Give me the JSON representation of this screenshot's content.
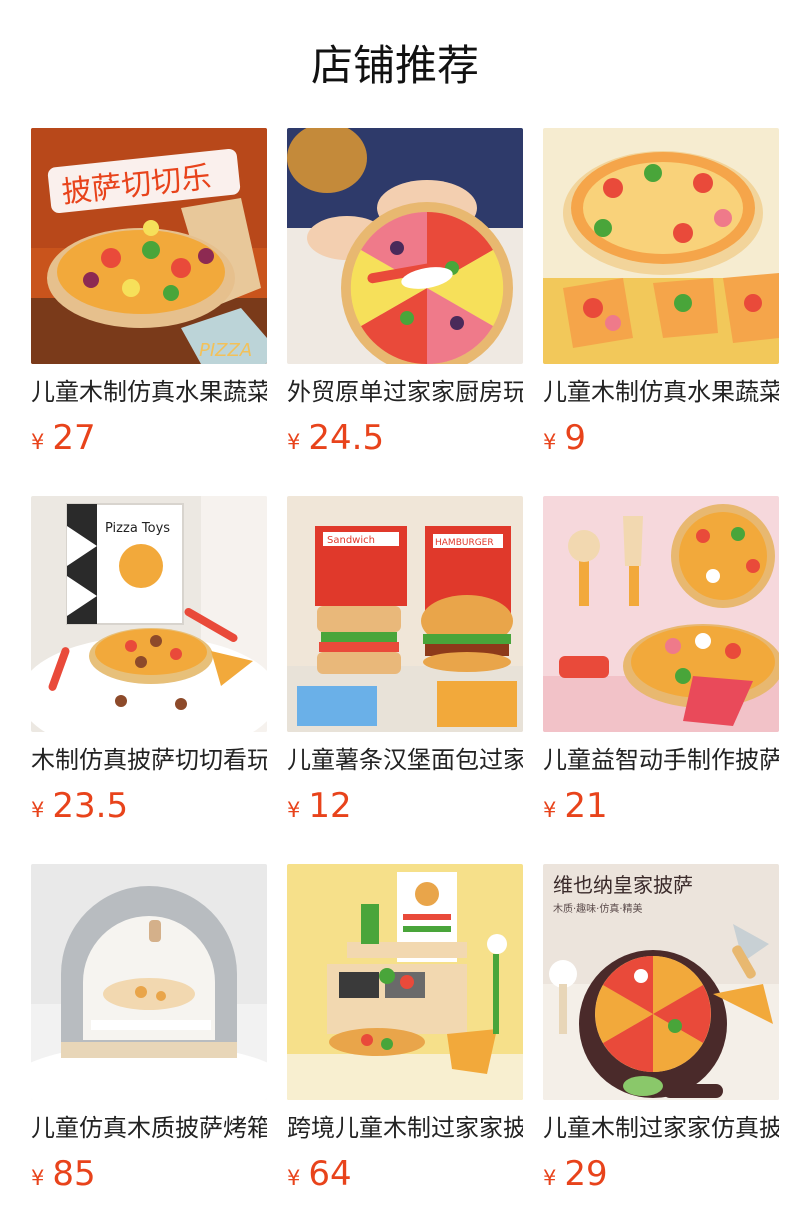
{
  "header": {
    "title": "店铺推荐"
  },
  "currency_symbol": "¥",
  "products": [
    {
      "name": "儿童木制仿真水果蔬菜切切乐",
      "price": "27",
      "image_text": "披萨切切乐",
      "image_subtext": "PIZZA"
    },
    {
      "name": "外贸原单过家家厨房玩具",
      "price": "24.5"
    },
    {
      "name": "儿童木制仿真水果蔬菜披萨",
      "price": "9"
    },
    {
      "name": "木制仿真披萨切切看玩具",
      "price": "23.5",
      "image_text": "Pizza Toys"
    },
    {
      "name": "儿童薯条汉堡面包过家家",
      "price": "12",
      "image_text": "Sandwich",
      "image_subtext": "HAMBURGER"
    },
    {
      "name": "儿童益智动手制作披萨",
      "price": "21"
    },
    {
      "name": "儿童仿真木质披萨烤箱",
      "price": "85"
    },
    {
      "name": "跨境儿童木制过家家披萨",
      "price": "64"
    },
    {
      "name": "儿童木制过家家仿真披萨",
      "price": "29",
      "image_text": "维也纳皇家披萨",
      "image_subtext": "木质·趣味·仿真·精美"
    }
  ]
}
